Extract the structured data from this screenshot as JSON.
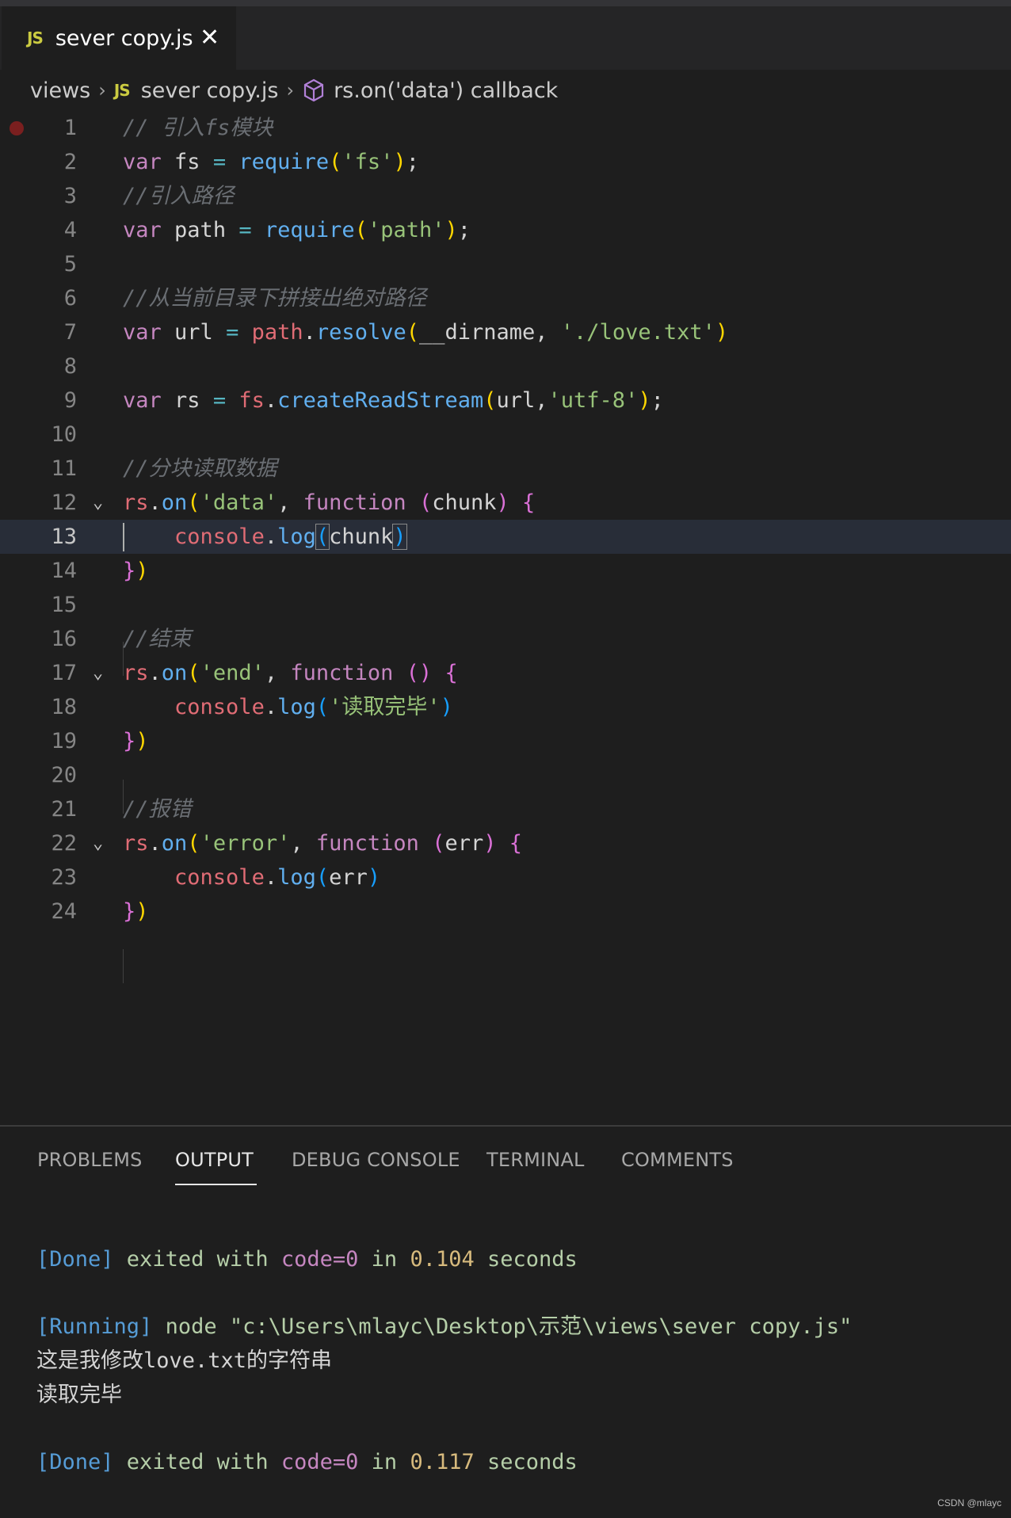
{
  "tab": {
    "badge": "JS",
    "title": "sever copy.js",
    "close": "✕"
  },
  "breadcrumb": {
    "folder": "views",
    "badge": "JS",
    "file": "sever copy.js",
    "symbol": "rs.on('data') callback",
    "sep": "›"
  },
  "editor": {
    "line_numbers": [
      "1",
      "2",
      "3",
      "4",
      "5",
      "6",
      "7",
      "8",
      "9",
      "10",
      "11",
      "12",
      "13",
      "14",
      "15",
      "16",
      "17",
      "18",
      "19",
      "20",
      "21",
      "22",
      "23",
      "24"
    ],
    "fold_glyph": "⌄",
    "current_line": "13"
  },
  "panel": {
    "tabs": [
      "PROBLEMS",
      "OUTPUT",
      "DEBUG CONSOLE",
      "TERMINAL",
      "COMMENTS"
    ],
    "active_tab": "OUTPUT"
  },
  "output": {
    "line1": {
      "tag": "[Done]",
      "t1": " exited with ",
      "code": "code=0",
      "t2": " in ",
      "num": "0.104",
      "t3": " seconds"
    },
    "line2": {
      "tag": "[Running]",
      "cmd": " node ",
      "path": "\"c:\\Users\\mlayc\\Desktop\\示范\\views\\sever copy.js\""
    },
    "line3": "这是我修改love.txt的字符串",
    "line4": "读取完毕",
    "line5": {
      "tag": "[Done]",
      "t1": " exited with ",
      "code": "code=0",
      "t2": " in ",
      "num": "0.117",
      "t3": " seconds"
    }
  },
  "watermark": "CSDN @mlayc",
  "colors": {
    "background": "#1e1e1e",
    "accent": "#e7e7e7",
    "breakpoint": "#7a1f1f"
  }
}
